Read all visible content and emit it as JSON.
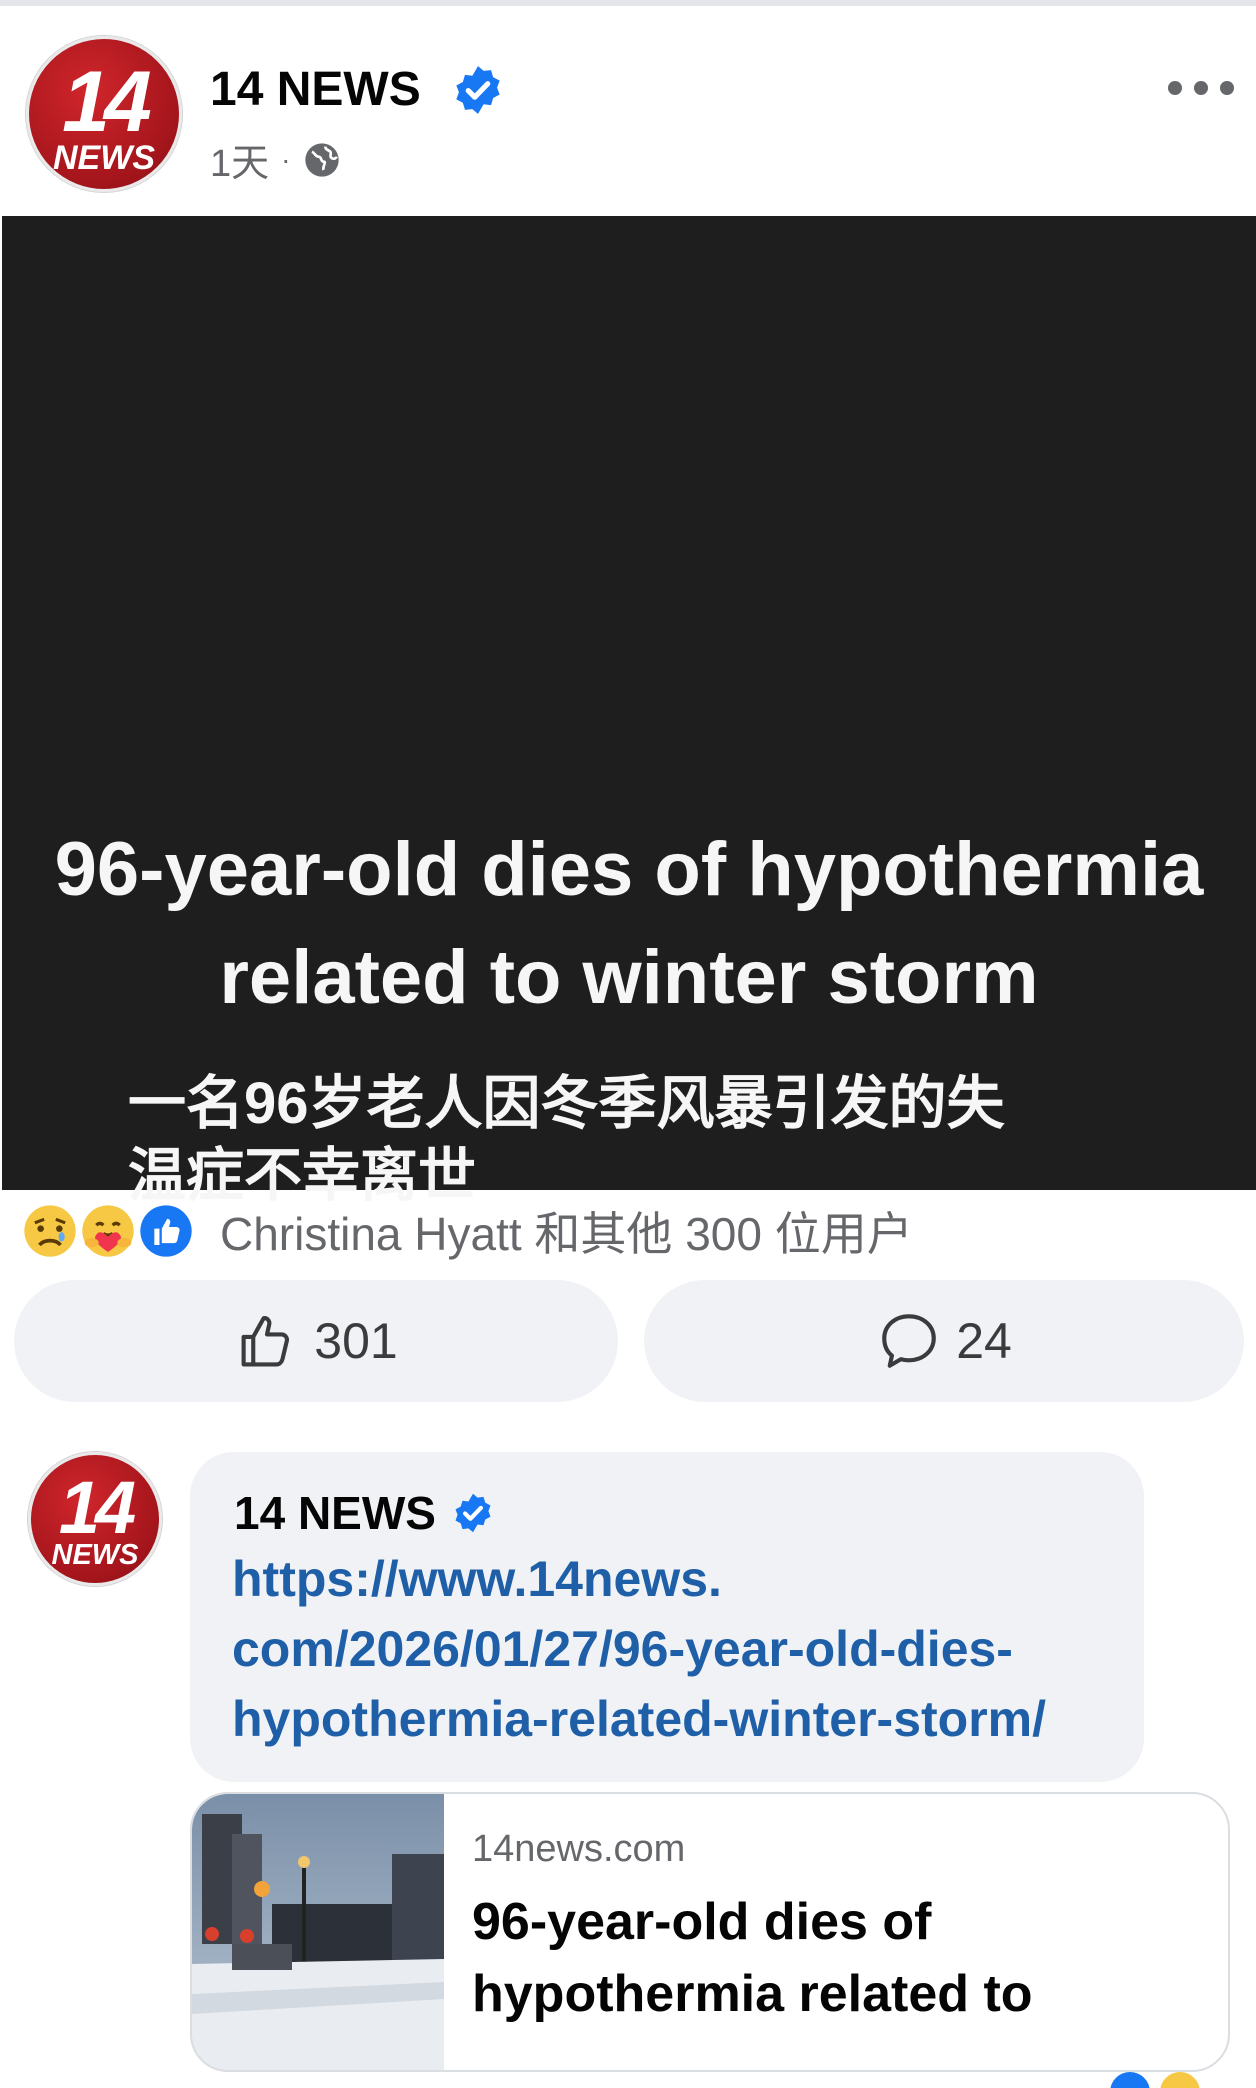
{
  "post": {
    "page_name": "14 NEWS",
    "logo": {
      "number": "14",
      "word": "NEWS"
    },
    "time": "1天",
    "separator": "·",
    "privacy_icon": "globe-icon",
    "more_icon": "more-options-icon"
  },
  "image": {
    "english_line1": "96-year-old dies of hypothermia",
    "english_line2": "related to winter storm",
    "chinese_line1": "一名96岁老人因冬季风暴引发的失",
    "chinese_line2": "温症不幸离世"
  },
  "reactions": {
    "icons": [
      "sad-reaction-icon",
      "care-reaction-icon",
      "like-reaction-icon"
    ],
    "summary": "Christina Hyatt 和其他 300 位用户"
  },
  "actions": {
    "like_count": "301",
    "comment_count": "24"
  },
  "comment": {
    "author": "14 NEWS",
    "link_text": "https://www.14news.com/2026/01/27/96-year-old-dies-hypothermia-related-winter-storm/",
    "link_line1": "https://www.14news.",
    "link_line2": "com/2026/01/27/96-year-old-dies-",
    "link_line3": "hypothermia-related-winter-storm/"
  },
  "link_preview": {
    "domain": "14news.com",
    "title_line1": "96-year-old dies of",
    "title_line2": "hypothermia related to"
  },
  "colors": {
    "brand_red": "#b81c22",
    "verified_blue": "#1877f2",
    "link_blue": "#1f5fa8",
    "image_bg": "#1e1e1f",
    "button_bg": "#f0f2f5"
  }
}
